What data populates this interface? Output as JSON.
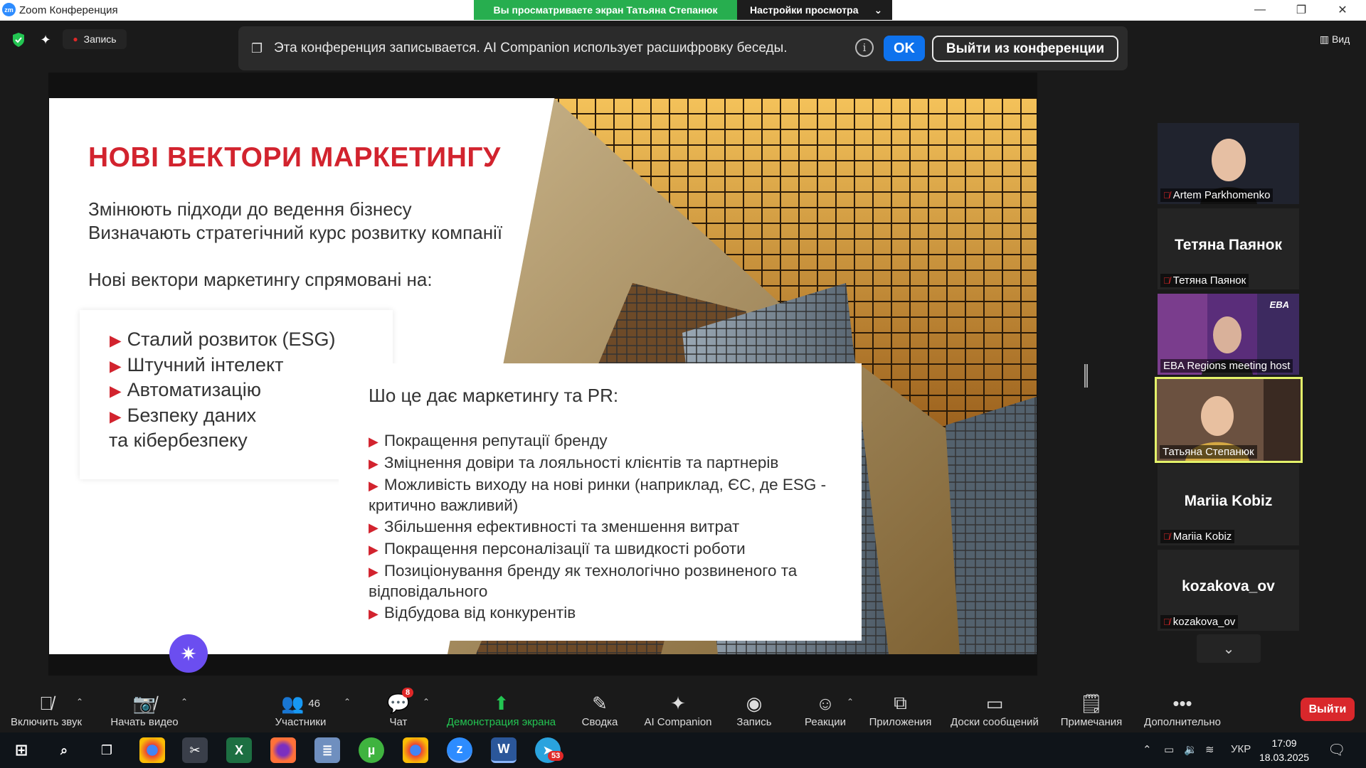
{
  "window": {
    "title": "Zoom Конференция",
    "logo": "zm"
  },
  "share_banner": {
    "text": "Вы просматриваете экран Татьяна Степанюк",
    "settings": "Настройки просмотра"
  },
  "top_left": {
    "record_label": "Запись",
    "view_label": "Вид"
  },
  "notice": {
    "text": "Эта конференция записывается. AI Companion использует расшифровку беседы.",
    "ok": "OK",
    "leave": "Выйти из конференции"
  },
  "slide": {
    "title": "НОВІ ВЕКТОРИ МАРКЕТИНГУ",
    "line1": "Змінюють підходи до ведення бізнесу",
    "line2": "Визначають стратегічний курс розвитку компанії",
    "line3": "Нові вектори маркетингу спрямовані на:",
    "box1": [
      "Сталий розвиток (ESG)",
      "Штучний інтелект",
      "Автоматизацію",
      "Безпеку даних"
    ],
    "box1_tail": "та кібербезпеку",
    "box2_heading": "Шо це дає маркетингу та PR:",
    "box2": [
      "Покращення репутації бренду",
      "Зміцнення довіри та лояльності клієнтів та партнерів",
      "Можливість виходу на нові ринки (наприклад, ЄС, де ESG - критично важливий)",
      "Збільшення ефективності та зменшення витрат",
      "Покращення персоналізації та швидкості роботи",
      "Позиціонування бренду як технологічно розвиненого та відповідального",
      "Відбудова від конкурентів"
    ]
  },
  "participants": [
    {
      "name": "Artem Parkhomenko",
      "big": ""
    },
    {
      "name": "Тетяна Паянок",
      "big": "Тетяна Паянок"
    },
    {
      "name": "EBA Regions meeting host",
      "big": ""
    },
    {
      "name": "Татьяна Степанюк",
      "big": ""
    },
    {
      "name": "Mariia Kobiz",
      "big": "Mariia Kobiz"
    },
    {
      "name": "kozakova_ov",
      "big": "kozakova_ov"
    }
  ],
  "eba_logo": "EBA",
  "toolbar": {
    "audio": "Включить звук",
    "video": "Начать видео",
    "participants": "Участники",
    "participants_count": "46",
    "chat": "Чат",
    "chat_badge": "8",
    "share": "Демонстрация экрана",
    "summary": "Сводка",
    "ai": "AI Companion",
    "record": "Запись",
    "reactions": "Реакции",
    "apps": "Приложения",
    "whiteboards": "Доски сообщений",
    "notes": "Примечания",
    "more": "Дополнительно",
    "leave": "Выйти"
  },
  "taskbar": {
    "lang": "УКР",
    "time": "17:09",
    "date": "18.03.2025",
    "telegram_badge": "53"
  },
  "colors": {
    "accent_red": "#d2232e",
    "zoom_blue": "#0e72ed",
    "share_green": "#27ae4f",
    "active_speaker": "#e4f26a"
  }
}
